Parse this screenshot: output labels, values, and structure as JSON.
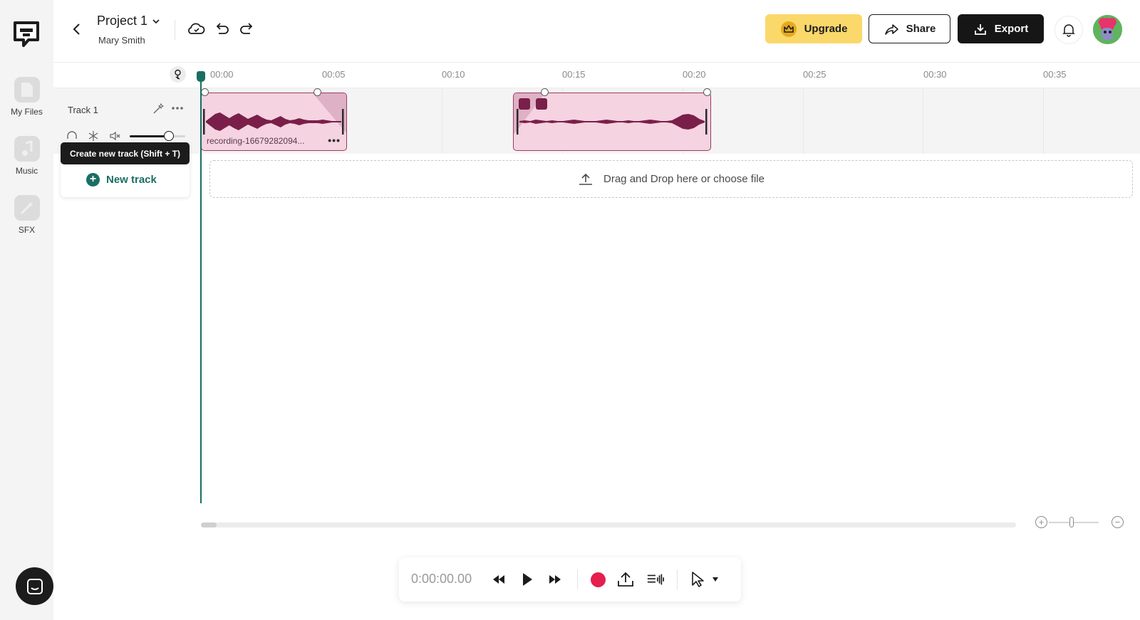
{
  "app": {
    "rail": {
      "items": [
        {
          "label": "My Files",
          "icon": "file-icon"
        },
        {
          "label": "Music",
          "icon": "music-note-icon"
        },
        {
          "label": "SFX",
          "icon": "magic-wand-icon"
        }
      ]
    },
    "header": {
      "project_title": "Project 1",
      "owner": "Mary Smith",
      "upgrade_label": "Upgrade",
      "share_label": "Share",
      "export_label": "Export"
    },
    "ruler": {
      "ticks": [
        "00:00",
        "00:05",
        "00:10",
        "00:15",
        "00:20",
        "00:25",
        "00:30",
        "00:35"
      ]
    },
    "tracks": [
      {
        "name": "Track 1",
        "volume": 0.7,
        "clips": [
          {
            "name": "recording-16679282094..."
          },
          {
            "name": ""
          }
        ]
      }
    ],
    "tooltip": {
      "text": "Create new track (Shift + T)"
    },
    "new_track_label": "New track",
    "dropzone_label": "Drag and Drop here or choose file",
    "transport": {
      "time": "0:00:00.00"
    },
    "colors": {
      "accent": "#1a6e63",
      "clip_fill": "#f5d3e1",
      "clip_wave": "#7a1f4a",
      "upgrade_bg": "#fad86a",
      "record": "#e61e4d"
    }
  }
}
